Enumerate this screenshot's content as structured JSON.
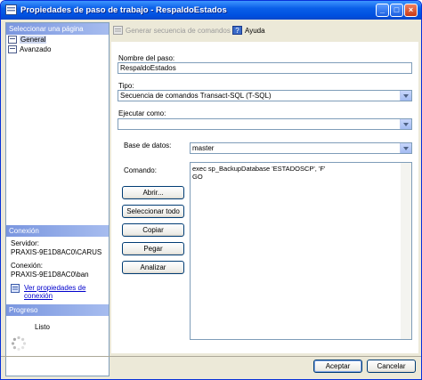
{
  "window": {
    "title": "Propiedades de paso de trabajo - RespaldoEstados"
  },
  "sidebar": {
    "header": "Seleccionar una página",
    "items": [
      {
        "label": "General",
        "selected": true
      },
      {
        "label": "Avanzado",
        "selected": false
      }
    ],
    "connection": {
      "header": "Conexión",
      "server_label": "Servidor:",
      "server_value": "PRAXIS-9E1D8AC0\\CARUS",
      "conn_label": "Conexión:",
      "conn_value": "PRAXIS-9E1D8AC0\\ban",
      "view_link": "Ver propiedades de conexión"
    },
    "progress": {
      "header": "Progreso",
      "status": "Listo"
    }
  },
  "toolbar": {
    "generate": "Generar secuencia de comandos",
    "help": "Ayuda"
  },
  "form": {
    "step_name_label": "Nombre del paso:",
    "step_name_value": "RespaldoEstados",
    "type_label": "Tipo:",
    "type_value": "Secuencia de comandos Transact-SQL (T-SQL)",
    "run_as_label": "Ejecutar como:",
    "run_as_value": "",
    "database_label": "Base de datos:",
    "database_value": "master",
    "command_label": "Comando:",
    "command_lines": [
      "exec sp_BackupDatabase 'ESTADOSCP', 'F'",
      "GO"
    ]
  },
  "buttons": {
    "open": "Abrir...",
    "select_all": "Seleccionar todo",
    "copy": "Copiar",
    "paste": "Pegar",
    "analyze": "Analizar"
  },
  "footer": {
    "ok": "Aceptar",
    "cancel": "Cancelar"
  }
}
